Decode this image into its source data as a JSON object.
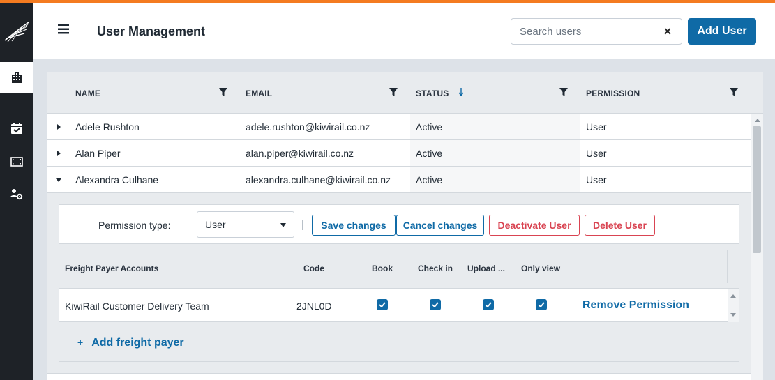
{
  "header": {
    "title": "User Management",
    "search_placeholder": "Search users",
    "search_value": "",
    "clear_label": "×",
    "add_user_label": "Add User"
  },
  "rail": {
    "items": [
      "logo-icon",
      "building-icon",
      "calendar-check-icon",
      "film-icon",
      "users-cog-icon"
    ],
    "active": "building-icon"
  },
  "table": {
    "columns": [
      {
        "label": "NAME"
      },
      {
        "label": "EMAIL"
      },
      {
        "label": "STATUS",
        "sorted": "descending"
      },
      {
        "label": "PERMISSION"
      }
    ],
    "rows": [
      {
        "name": "Adele Rushton",
        "email": "adele.rushton@kiwirail.co.nz",
        "status": "Active",
        "permission": "User",
        "expanded": false
      },
      {
        "name": "Alan Piper",
        "email": "alan.piper@kiwirail.co.nz",
        "status": "Active",
        "permission": "User",
        "expanded": false
      },
      {
        "name": "Alexandra Culhane",
        "email": "alexandra.culhane@kiwirail.co.nz",
        "status": "Active",
        "permission": "User",
        "expanded": true
      }
    ]
  },
  "detail": {
    "permission_label": "Permission type:",
    "permission_value": "User",
    "save_label": "Save changes",
    "cancel_label": "Cancel changes",
    "deactivate_label": "Deactivate User",
    "delete_label": "Delete User",
    "sub_columns": [
      "Freight Payer Accounts",
      "Code",
      "Book",
      "Check in",
      "Upload ...",
      "Only view"
    ],
    "accounts": [
      {
        "name": "KiwiRail Customer Delivery Team",
        "code": "2JNL0D",
        "book": true,
        "check_in": true,
        "upload": true,
        "only_view": true,
        "remove_label": "Remove Permission"
      }
    ],
    "add_freight_label": "Add freight payer",
    "add_freight_plus": "+"
  },
  "colors": {
    "accent": "#0f6aa6",
    "danger": "#d94452",
    "top_line": "#f47b20",
    "rail": "#1e2227"
  }
}
